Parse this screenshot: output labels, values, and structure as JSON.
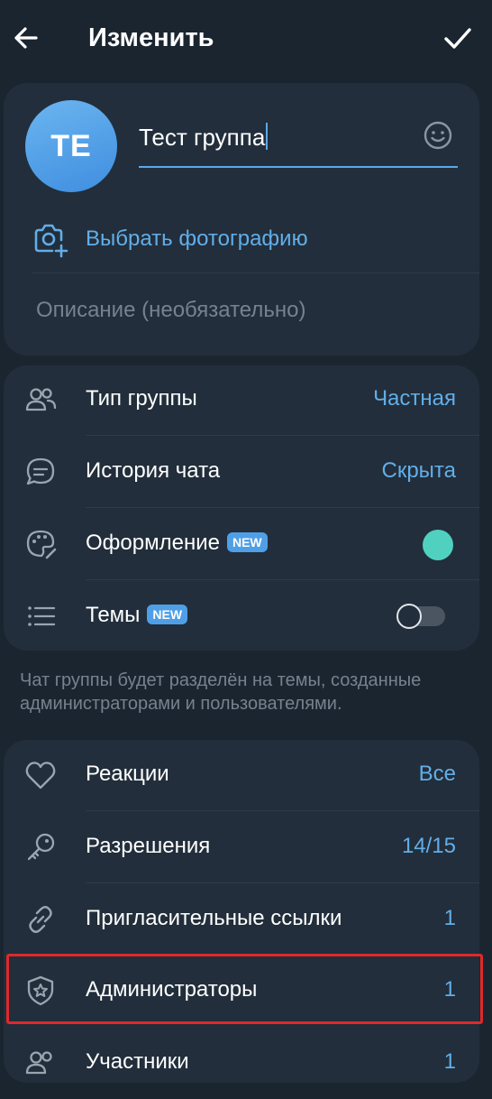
{
  "header": {
    "title": "Изменить"
  },
  "profile": {
    "avatar_initials": "TE",
    "name_value": "Тест группа",
    "photo_label": "Выбрать фотографию",
    "description_placeholder": "Описание (необязательно)"
  },
  "settings": [
    {
      "label": "Тип группы",
      "value": "Частная",
      "icon": "people-icon"
    },
    {
      "label": "История чата",
      "value": "Скрыта",
      "icon": "chat-bubble-icon"
    },
    {
      "label": "Оформление",
      "badge": "NEW",
      "icon": "palette-icon",
      "color": "#50d1c0"
    },
    {
      "label": "Темы",
      "badge": "NEW",
      "icon": "list-icon",
      "toggle": "off"
    }
  ],
  "hint": "Чат группы будет разделён на темы, созданные администраторами и пользователями.",
  "management": [
    {
      "label": "Реакции",
      "value": "Все",
      "icon": "heart-icon"
    },
    {
      "label": "Разрешения",
      "value": "14/15",
      "icon": "key-icon"
    },
    {
      "label": "Пригласительные ссылки",
      "value": "1",
      "icon": "link-icon"
    },
    {
      "label": "Администраторы",
      "value": "1",
      "icon": "shield-star-icon",
      "highlighted": true
    },
    {
      "label": "Участники",
      "value": "1",
      "icon": "members-icon"
    }
  ],
  "colors": {
    "background": "#1b2530",
    "card": "#222e3b",
    "accent": "#62aee8",
    "highlight": "#e0282a"
  }
}
